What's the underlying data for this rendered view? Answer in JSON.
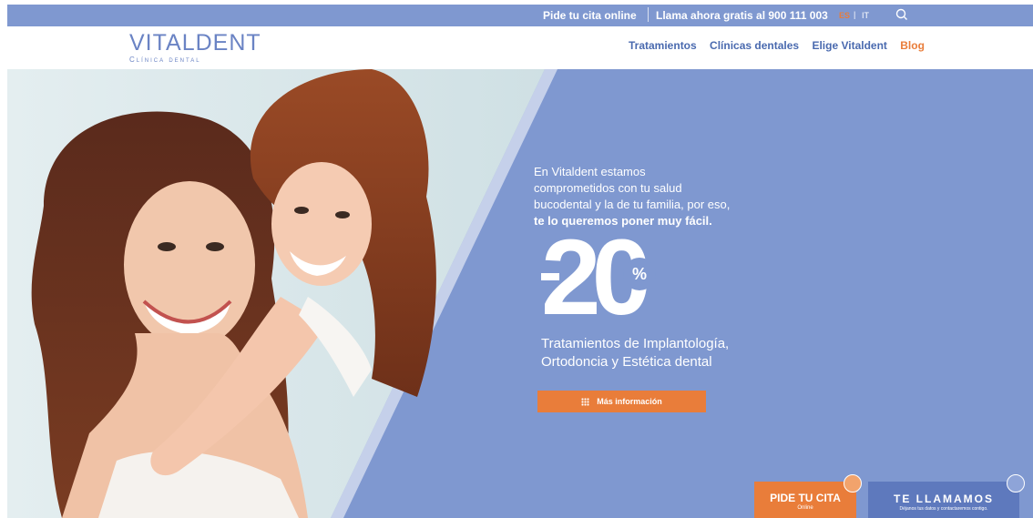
{
  "topbar": {
    "cta_online": "Pide tu cita online",
    "phone_text": "Llama ahora gratis al 900 111 003",
    "lang_es": "ES",
    "lang_sep": "|",
    "lang_it": "IT",
    "search_icon": "search-icon"
  },
  "header": {
    "logo_name": "VITALDENT",
    "logo_sub": "Clínica dental",
    "nav": {
      "tratamientos": "Tratamientos",
      "clinicas": "Clínicas dentales",
      "elige": "Elige Vitaldent",
      "blog": "Blog"
    }
  },
  "hero": {
    "text_line1": "En Vitaldent estamos",
    "text_line2": "comprometidos con tu salud",
    "text_line3": "bucodental y la de tu familia, por eso,",
    "text_bold": "te lo queremos poner muy fácil.",
    "discount_number": "20",
    "discount_percent": "%",
    "sub_line1": "Tratamientos de Implantología,",
    "sub_line2": "Ortodoncia y Estética dental",
    "more_button": "Más información"
  },
  "floating": {
    "cita_title": "PIDE TU CITA",
    "cita_sub": "Online",
    "llamamos_title": "TE LLAMAMOS",
    "llamamos_sub": "Déjanos tus datos y contactaremos contigo."
  },
  "colors": {
    "brand_blue": "#7f98d0",
    "nav_blue": "#4a6aaf",
    "accent_orange": "#e97d3a"
  }
}
